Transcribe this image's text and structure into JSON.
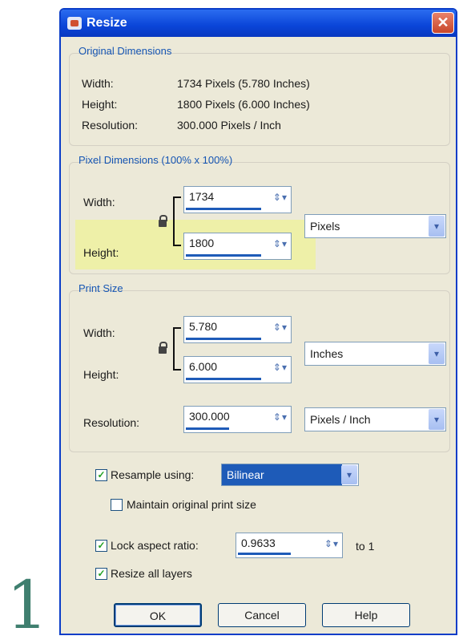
{
  "step_numeral": "1",
  "window": {
    "title": "Resize",
    "close_glyph": "✕"
  },
  "original": {
    "title": "Original Dimensions",
    "width_label": "Width:",
    "width_value": "1734 Pixels (5.780 Inches)",
    "height_label": "Height:",
    "height_value": "1800 Pixels (6.000 Inches)",
    "resolution_label": "Resolution:",
    "resolution_value": "300.000 Pixels / Inch"
  },
  "pixel_dims": {
    "title": "Pixel Dimensions (100% x 100%)",
    "width_label": "Width:",
    "width_value": "1734",
    "height_label": "Height:",
    "height_value": "1800",
    "units": "Pixels"
  },
  "print_size": {
    "title": "Print Size",
    "width_label": "Width:",
    "width_value": "5.780",
    "height_label": "Height:",
    "height_value": "6.000",
    "units": "Inches",
    "resolution_label": "Resolution:",
    "resolution_value": "300.000",
    "resolution_units": "Pixels / Inch"
  },
  "resample": {
    "label": "Resample using:",
    "checked": true,
    "method": "Bilinear"
  },
  "maintain": {
    "label": "Maintain original print size",
    "checked": false
  },
  "aspect": {
    "label": "Lock aspect ratio:",
    "checked": true,
    "value": "0.9633",
    "suffix": "to 1"
  },
  "resize_layers": {
    "label": "Resize all layers",
    "checked": true
  },
  "buttons": {
    "ok": "OK",
    "cancel": "Cancel",
    "help": "Help"
  },
  "icons": {
    "lock": "lock-icon",
    "spin": "spin-arrows-icon",
    "dropdown": "chevron-down-icon"
  },
  "colors": {
    "titlebar": "#0a45d8",
    "group_title": "#1656b4",
    "highlight": "#eef0a8",
    "selection": "#1e5bb8"
  }
}
